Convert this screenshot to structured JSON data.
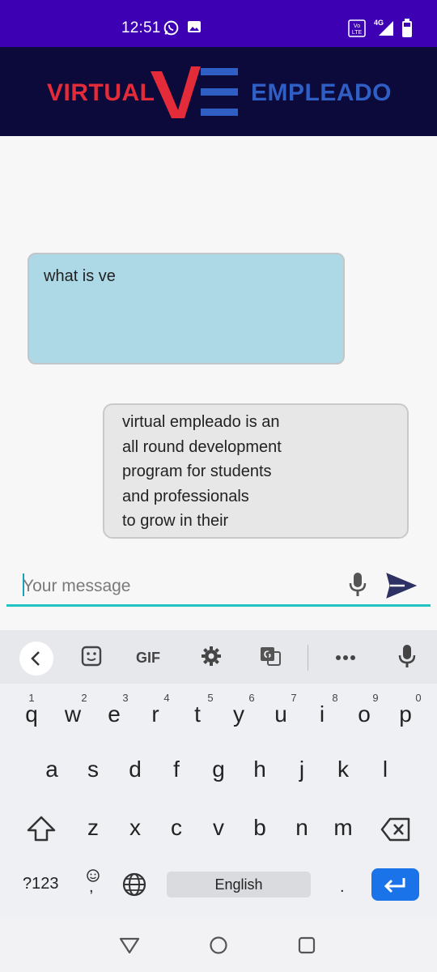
{
  "status_bar": {
    "time": "12:51",
    "icons": [
      "whatsapp-icon",
      "image-icon",
      "volte-icon",
      "signal-4g-icon",
      "battery-icon"
    ],
    "network_label": "4G",
    "volte_label": "Vo LTE"
  },
  "header": {
    "logo_left": "VIRTUAL",
    "logo_right": "EMPLEADO",
    "colors": {
      "background": "#0b0a3b",
      "red": "#e32b3a",
      "blue": "#2f5ec4"
    }
  },
  "chat": {
    "messages": [
      {
        "sender": "user",
        "lines": [
          "what is ve"
        ]
      },
      {
        "sender": "bot",
        "lines": [
          "virtual empleado is an",
          "all round development",
          "program for students",
          "and professionals",
          "to grow in their"
        ]
      }
    ],
    "colors": {
      "user_bubble": "#add8e6",
      "bot_bubble": "#e7e7e7"
    }
  },
  "input": {
    "placeholder": "Your message",
    "value": "",
    "mic_icon": "mic-icon",
    "send_icon": "send-icon"
  },
  "keyboard": {
    "toolbar": [
      "back-icon",
      "sticker-icon",
      "GIF",
      "settings-icon",
      "translate-icon",
      "more-icon",
      "mic-icon"
    ],
    "gif_label": "GIF",
    "row1": [
      {
        "num": "1",
        "ch": "q"
      },
      {
        "num": "2",
        "ch": "w"
      },
      {
        "num": "3",
        "ch": "e"
      },
      {
        "num": "4",
        "ch": "r"
      },
      {
        "num": "5",
        "ch": "t"
      },
      {
        "num": "6",
        "ch": "y"
      },
      {
        "num": "7",
        "ch": "u"
      },
      {
        "num": "8",
        "ch": "i"
      },
      {
        "num": "9",
        "ch": "o"
      },
      {
        "num": "0",
        "ch": "p"
      }
    ],
    "row2": [
      "a",
      "s",
      "d",
      "f",
      "g",
      "h",
      "j",
      "k",
      "l"
    ],
    "row3": [
      "z",
      "x",
      "c",
      "v",
      "b",
      "n",
      "m"
    ],
    "symbols_label": "?123",
    "comma_label": ",",
    "space_label": "English",
    "period_label": ".",
    "enter_color": "#1a73e8"
  },
  "nav_bar": [
    "back-nav-icon",
    "home-nav-icon",
    "recents-nav-icon"
  ]
}
